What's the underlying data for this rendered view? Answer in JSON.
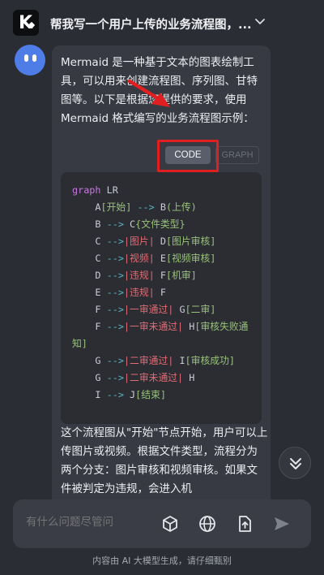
{
  "header": {
    "title": "帮我写一个用户上传的业务流程图，..."
  },
  "message": {
    "intro": "Mermaid 是一种基于文本的图表绘制工具，可以用来创建流程图、序列图、甘特图等。以下是根据您提供的要求，使用 Mermaid 格式编写的业务流程图示例：",
    "toggle": {
      "code_label": "CODE",
      "graph_label": "GRAPH"
    },
    "code_lines": [
      "graph LR",
      "    A[开始] --> B(上传)",
      "    B --> C{文件类型}",
      "    C -->|图片| D[图片审核]",
      "    C -->|视频| E[视频审核]",
      "    D -->|违规| F[机审]",
      "    E -->|违规| F",
      "    F -->|一审通过| G[二审]",
      "    F -->|一审未通过| H[审核失败通知]",
      "    G -->|二审通过| I[审核成功]",
      "    G -->|二审未通过| H",
      "    I --> J[结束]"
    ],
    "outro": "这个流程图从\"开始\"节点开始，用户可以上传图片或视频。根据文件类型，流程分为两个分支：图片审核和视频审核。如果文件被判定为违规，会进入机"
  },
  "input": {
    "placeholder": "有什么问题尽管问"
  },
  "footer": {
    "notice": "内容由 AI 大模型生成，请仔细甄别"
  },
  "icons": {
    "cube": "cube-icon",
    "globe": "globe-icon",
    "upload": "upload-file-icon",
    "send": "send-icon",
    "scroll": "double-chevron-down-icon"
  },
  "colors": {
    "background": "#2b2d34",
    "bubble": "#373a42",
    "highlight": "#e02020",
    "avatar": "#4f7de8"
  }
}
